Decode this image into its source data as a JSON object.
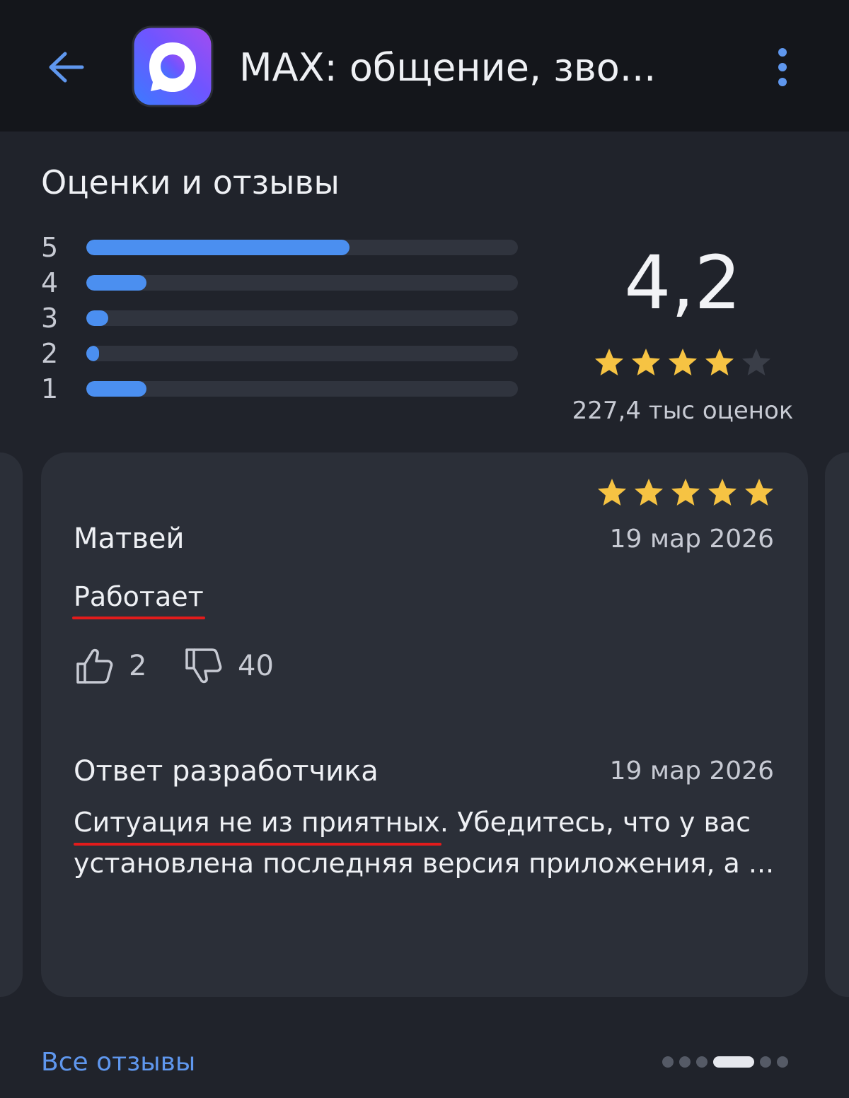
{
  "header": {
    "app_title": "MAX: общение, зво...",
    "back_icon": "arrow-left-icon",
    "menu_icon": "more-vertical-icon",
    "app_icon": "max-logo-icon",
    "accent_color": "#4b8ff0"
  },
  "ratings": {
    "title": "Оценки и отзывы",
    "average": "4,2",
    "average_stars": 4,
    "count_label": "227,4 тыс оценок",
    "distribution": [
      {
        "star": "5",
        "share": 0.61
      },
      {
        "star": "4",
        "share": 0.14
      },
      {
        "star": "3",
        "share": 0.05
      },
      {
        "star": "2",
        "share": 0.03
      },
      {
        "star": "1",
        "share": 0.14
      }
    ]
  },
  "review": {
    "stars": 5,
    "author": "Матвей",
    "date": "19 мар 2026",
    "text": "Работает",
    "likes": "2",
    "dislikes": "40",
    "like_icon": "thumbs-up-icon",
    "dislike_icon": "thumbs-down-icon",
    "developer_reply": {
      "title": "Ответ разработчика",
      "date": "19 мар 2026",
      "text_line1_underlined": "Ситуация не из приятных.",
      "text_line1_rest": " Убедитесь, что у вас",
      "text_line2": "установлена последняя версия приложения, а ..."
    }
  },
  "footer": {
    "all_reviews_label": "Все отзывы",
    "pager": {
      "count": 6,
      "active": 3
    }
  }
}
